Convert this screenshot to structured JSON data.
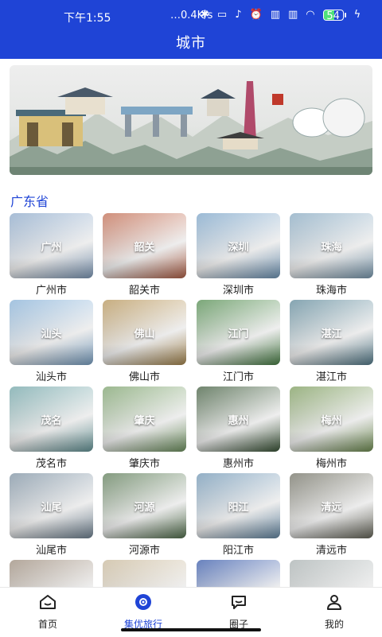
{
  "status_bar": {
    "time": "下午1:55",
    "net_speed": "…0.4K/s",
    "battery": "54",
    "battery_level": 0.54,
    "icons": [
      "bluetooth-icon",
      "vibrate-icon",
      "mute-icon",
      "alarm-icon",
      "hd-icon",
      "hd-icon",
      "wifi-icon",
      "battery-icon",
      "charging-icon"
    ]
  },
  "header": {
    "title": "城市"
  },
  "section": {
    "title": "广东省"
  },
  "cities": [
    {
      "label": "广州",
      "name": "广州市",
      "color": "#8aa7c8"
    },
    {
      "label": "韶关",
      "name": "韶关市",
      "color": "#c06a4f"
    },
    {
      "label": "深圳",
      "name": "深圳市",
      "color": "#7aa3c7"
    },
    {
      "label": "珠海",
      "name": "珠海市",
      "color": "#86a8c0"
    },
    {
      "label": "汕头",
      "name": "汕头市",
      "color": "#86b0d6"
    },
    {
      "label": "佛山",
      "name": "佛山市",
      "color": "#b59357"
    },
    {
      "label": "江门",
      "name": "江门市",
      "color": "#4f8a4c"
    },
    {
      "label": "湛江",
      "name": "湛江市",
      "color": "#5d8798"
    },
    {
      "label": "茂名",
      "name": "茂名市",
      "color": "#6fa3a6"
    },
    {
      "label": "肇庆",
      "name": "肇庆市",
      "color": "#7aa06a"
    },
    {
      "label": "惠州",
      "name": "惠州市",
      "color": "#3f5b3c"
    },
    {
      "label": "梅州",
      "name": "梅州市",
      "color": "#7a9a5a"
    },
    {
      "label": "汕尾",
      "name": "汕尾市",
      "color": "#7b8fa0"
    },
    {
      "label": "河源",
      "name": "河源市",
      "color": "#5b7a55"
    },
    {
      "label": "阳江",
      "name": "阳江市",
      "color": "#6f95b3"
    },
    {
      "label": "清远",
      "name": "清远市",
      "color": "#6f6f62"
    },
    {
      "label": "",
      "name": "",
      "color": "#9a8a7a"
    },
    {
      "label": "",
      "name": "",
      "color": "#c8b89a"
    },
    {
      "label": "",
      "name": "",
      "color": "#3658a8"
    },
    {
      "label": "",
      "name": "",
      "color": "#a8b0b0"
    }
  ],
  "nav": {
    "home": "首页",
    "travel": "集优旅行",
    "circle": "圈子",
    "mine": "我的"
  },
  "colors": {
    "primary": "#1f44d6"
  }
}
